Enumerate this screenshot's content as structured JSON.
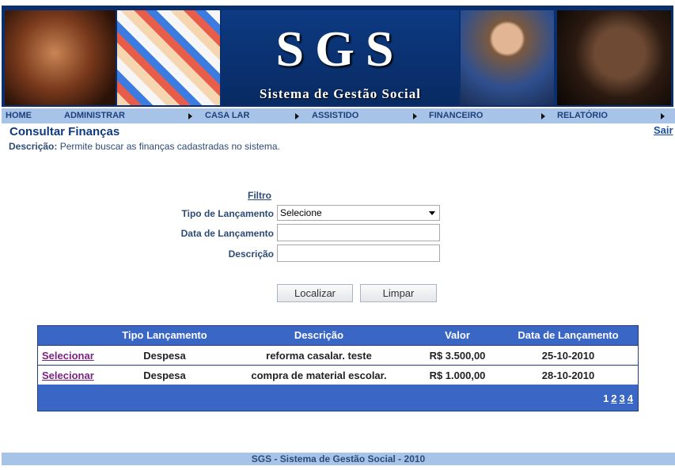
{
  "header": {
    "logo_text": "SGS",
    "logo_subtitle": "Sistema de Gestão Social"
  },
  "nav": {
    "items": [
      "HOME",
      "ADMINISTRAR",
      "CASA LAR",
      "ASSISTIDO",
      "FINANCEIRO",
      "RELATÓRIO"
    ]
  },
  "page": {
    "title": "Consultar Finanças",
    "logout": "Sair",
    "description_label": "Descrição:",
    "description_text": "Permite buscar as finanças cadastradas no sistema."
  },
  "filter": {
    "heading": "Filtro",
    "tipo_label": "Tipo de Lançamento",
    "tipo_value": "Selecione",
    "data_label": "Data de Lançamento",
    "data_value": "",
    "descricao_label": "Descrição",
    "descricao_value": "",
    "search_button": "Localizar",
    "clear_button": "Limpar"
  },
  "table": {
    "columns": [
      "",
      "Tipo Lançamento",
      "Descrição",
      "Valor",
      "Data de Lançamento"
    ],
    "rows": [
      {
        "action": "Selecionar",
        "tipo": "Despesa",
        "descricao": "reforma casalar. teste",
        "valor": "R$ 3.500,00",
        "data": "25-10-2010"
      },
      {
        "action": "Selecionar",
        "tipo": "Despesa",
        "descricao": "compra de material escolar.",
        "valor": "R$ 1.000,00",
        "data": "28-10-2010"
      }
    ],
    "pages": [
      "1",
      "2",
      "3",
      "4"
    ]
  },
  "footer": {
    "text": "SGS - Sistema de Gestão Social - 2010"
  },
  "colors": {
    "banner": "#0a2f6e",
    "nav_bar": "#a7c4e8",
    "table_header": "#3a66c6",
    "link_visited": "#7a2382"
  }
}
